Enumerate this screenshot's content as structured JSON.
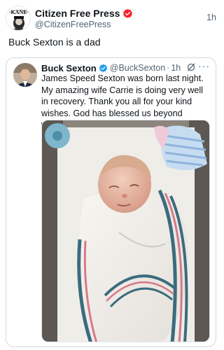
{
  "outer_tweet": {
    "name": "Citizen Free Press",
    "handle": "@CitizenFreePress",
    "time": "1h",
    "text": "Buck Sexton is a dad",
    "avatar_text": "KANE",
    "verified_color": "#f4212e"
  },
  "quoted_tweet": {
    "name": "Buck Sexton",
    "handle": "@BuckSexton",
    "separator": "·",
    "time": "1h",
    "more": "···",
    "text": "James Speed Sexton was born last night. My amazing wife Carrie is doing very well in recovery. Thank you all for your kind wishes. God has blessed us beyond words.",
    "verified_color": "#1d9bf0",
    "photo_icon": "newborn-photo"
  }
}
